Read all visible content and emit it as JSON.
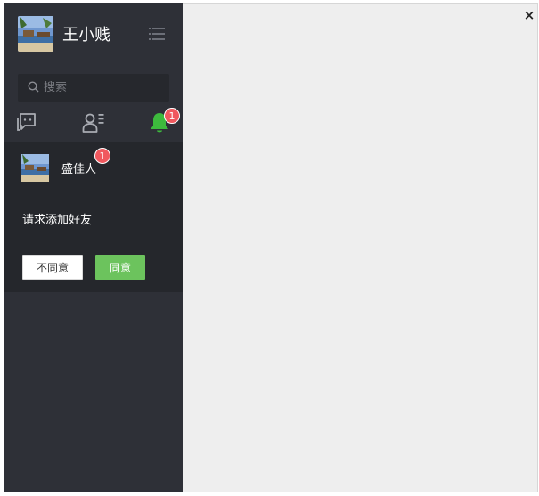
{
  "user": {
    "name": "王小贱"
  },
  "search": {
    "placeholder": "搜索"
  },
  "tabs": {
    "messages_icon": "chat-bubbles-icon",
    "contacts_icon": "contact-list-icon",
    "notifications_icon": "bell-icon",
    "notifications_badge": "1"
  },
  "friend_request": {
    "name": "盛佳人",
    "badge": "1",
    "message": "请求添加好友",
    "reject_label": "不同意",
    "accept_label": "同意"
  },
  "window": {
    "close_glyph": "×"
  },
  "colors": {
    "sidebar_bg": "#2e3037",
    "panel_bg": "#25272c",
    "accent_green": "#6cc35d",
    "bell_green": "#3dba3d",
    "badge_red": "#f0585e",
    "content_bg": "#eeeeee"
  }
}
